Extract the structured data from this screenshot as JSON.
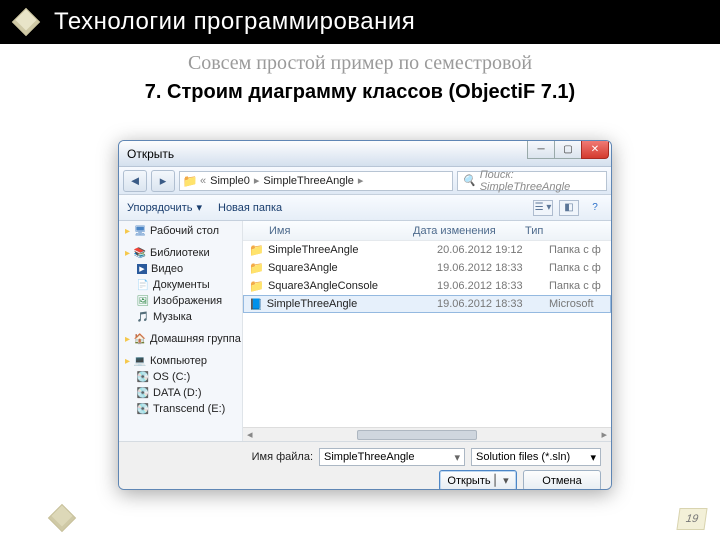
{
  "slide": {
    "title": "Технологии программирования",
    "subtitle": "Совсем простой пример по семестровой",
    "step": "7. Строим диаграмму классов (ObjectiF 7.1)",
    "page_number": "19"
  },
  "dialog": {
    "title": "Открыть",
    "nav": {
      "back": "◄",
      "fwd": "▸",
      "crumb_prefix": "«",
      "crumb1": "Simple0",
      "crumb2": "SimpleThreeAngle",
      "search_placeholder": "Поиск: SimpleThreeAngle"
    },
    "toolbar": {
      "organize": "Упорядочить",
      "new_folder": "Новая папка"
    },
    "sidebar": [
      {
        "label": "Рабочий стол",
        "icon": "desktop"
      },
      {
        "label": "Библиотеки",
        "icon": "lib"
      },
      {
        "label": "Видео",
        "icon": "vid",
        "lvl": 1
      },
      {
        "label": "Документы",
        "icon": "doc",
        "lvl": 1
      },
      {
        "label": "Изображения",
        "icon": "img",
        "lvl": 1
      },
      {
        "label": "Музыка",
        "icon": "mus",
        "lvl": 1
      },
      {
        "label": "Домашняя группа",
        "icon": "home"
      },
      {
        "label": "Компьютер",
        "icon": "comp"
      },
      {
        "label": "OS (C:)",
        "icon": "drive",
        "lvl": 2
      },
      {
        "label": "DATA (D:)",
        "icon": "drive",
        "lvl": 2
      },
      {
        "label": "Transcend (E:)",
        "icon": "drive",
        "lvl": 2
      }
    ],
    "columns": {
      "name": "Имя",
      "date": "Дата изменения",
      "type": "Тип"
    },
    "rows": [
      {
        "name": "SimpleThreeAngle",
        "date": "20.06.2012 19:12",
        "type": "Папка с ф",
        "icon": "folder"
      },
      {
        "name": "Square3Angle",
        "date": "19.06.2012 18:33",
        "type": "Папка с ф",
        "icon": "folder"
      },
      {
        "name": "Square3AngleConsole",
        "date": "19.06.2012 18:33",
        "type": "Папка с ф",
        "icon": "folder"
      },
      {
        "name": "SimpleThreeAngle",
        "date": "19.06.2012 18:33",
        "type": "Microsoft",
        "icon": "sln",
        "selected": true
      }
    ],
    "footer": {
      "filename_label": "Имя файла:",
      "filename_value": "SimpleThreeAngle",
      "filter": "Solution files (*.sln)",
      "open": "Открыть",
      "cancel": "Отмена"
    }
  }
}
